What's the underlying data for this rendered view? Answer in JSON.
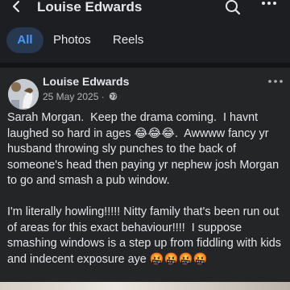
{
  "header": {
    "title": "Louise Edwards"
  },
  "tabs": [
    {
      "label": "All",
      "active": true
    },
    {
      "label": "Photos",
      "active": false
    },
    {
      "label": "Reels",
      "active": false
    }
  ],
  "post": {
    "author": "Louise Edwards",
    "date": "25 May 2025",
    "separator": " · ",
    "privacy_icon": "globe-icon",
    "paragraph_1": "Sarah Morgan.  Keep the drama coming.  I havnt laughed so hard in ages 😂😂😂.  Awwww fancy yr husband throwing sly punches to the back of someone's head then paying yr nephew josh Morgan to go and smash a pub window.",
    "paragraph_2": "I'm literally howling!!!!! Nitty family that's been run out of areas for this exact behaviour!!!!  I suppose smashing windows is a step up from fiddling with kids and indecent exposure aye 🤬🤬🤬🤬"
  },
  "colors": {
    "background": "#1c1e21",
    "card": "#242526",
    "accent": "#4599ff",
    "active_tab_bg": "#263951",
    "secondary_text": "#b0b3b8"
  }
}
